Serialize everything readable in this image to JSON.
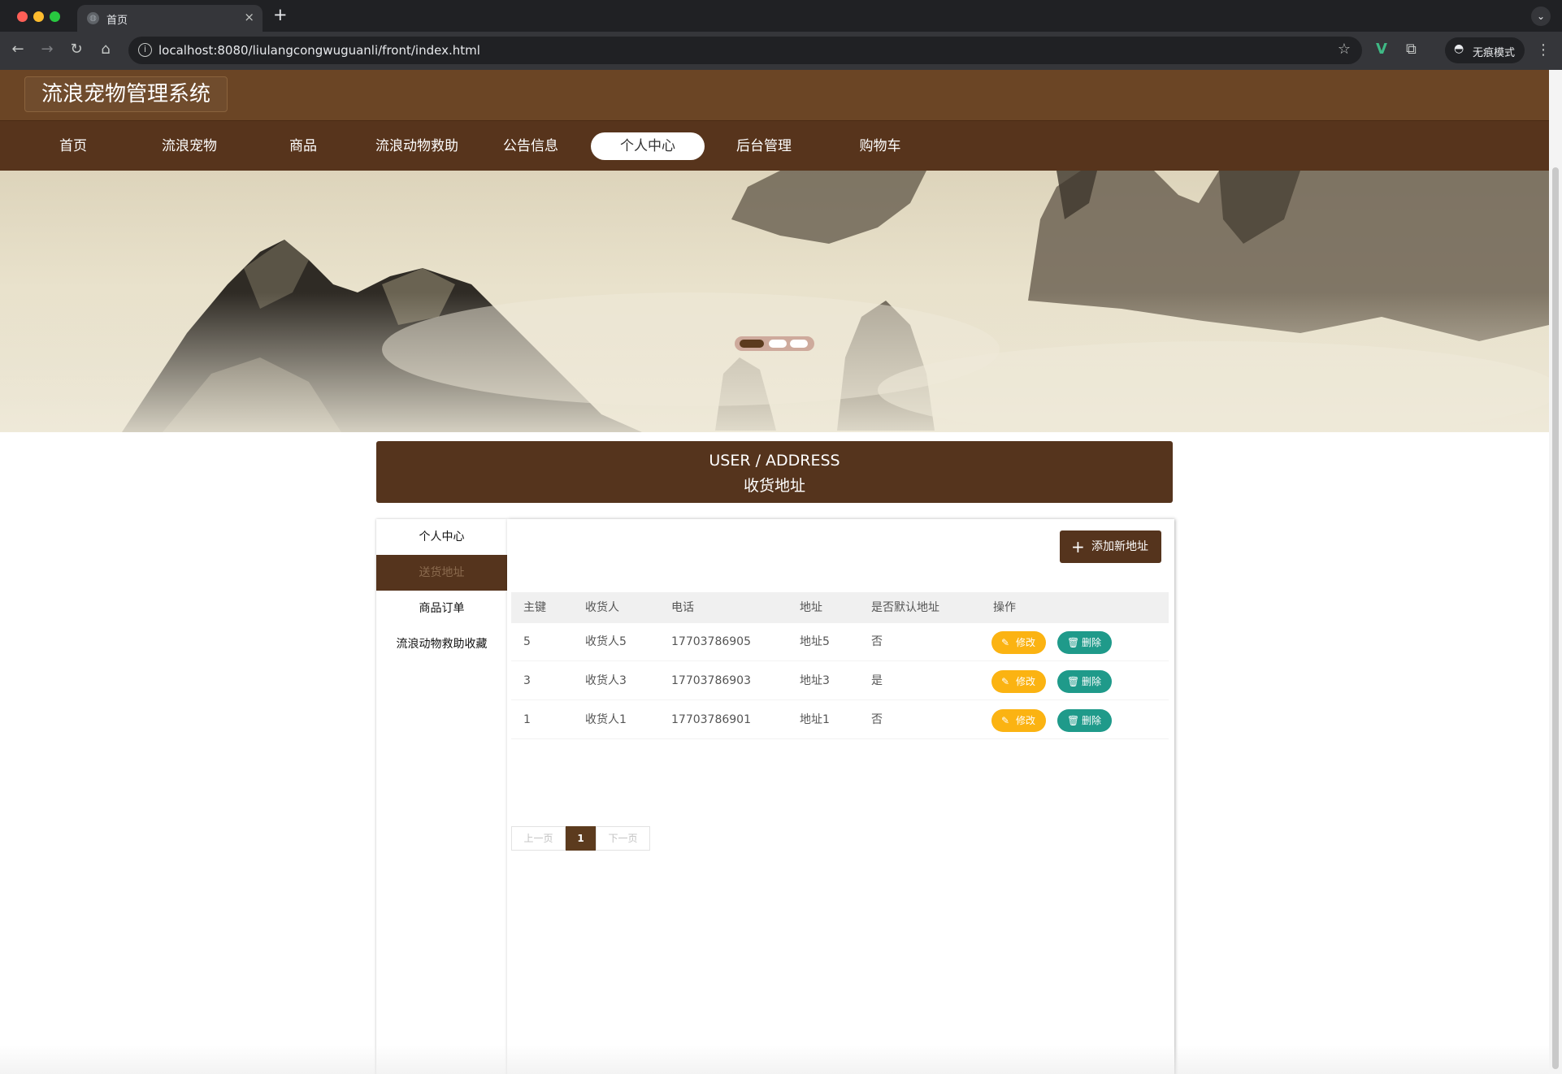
{
  "browser": {
    "tab_title": "首页",
    "tab_close": "×",
    "new_tab": "+",
    "url": "localhost:8080/liulangcongwuguanli/front/index.html",
    "incognito_label": "无痕模式",
    "icons": [
      "back-icon",
      "forward-icon",
      "reload-icon",
      "home-icon",
      "info-icon",
      "star-icon",
      "vue-devtools-icon",
      "extensions-icon",
      "incognito-icon",
      "menu-icon"
    ]
  },
  "header": {
    "brand": "流浪宠物管理系统"
  },
  "nav": {
    "items": [
      {
        "label": "首页"
      },
      {
        "label": "流浪宠物"
      },
      {
        "label": "商品"
      },
      {
        "label": "流浪动物救助"
      },
      {
        "label": "公告信息"
      },
      {
        "label": "个人中心",
        "active": true
      },
      {
        "label": "后台管理"
      },
      {
        "label": "购物车"
      }
    ]
  },
  "banner": {
    "slides": 3,
    "active_slide": 1
  },
  "section": {
    "title_en": "USER / ADDRESS",
    "title_cn": "收货地址"
  },
  "sidebar": {
    "items": [
      {
        "label": "个人中心"
      },
      {
        "label": "送货地址",
        "active": true
      },
      {
        "label": "商品订单"
      },
      {
        "label": "流浪动物救助收藏"
      }
    ]
  },
  "content": {
    "add_button": "添加新地址",
    "columns": [
      "主键",
      "收货人",
      "电话",
      "地址",
      "是否默认地址",
      "操作"
    ],
    "rows": [
      {
        "id": "5",
        "name": "收货人5",
        "phone": "17703786905",
        "address": "地址5",
        "default": "否"
      },
      {
        "id": "3",
        "name": "收货人3",
        "phone": "17703786903",
        "address": "地址3",
        "default": "是"
      },
      {
        "id": "1",
        "name": "收货人1",
        "phone": "17703786901",
        "address": "地址1",
        "default": "否"
      }
    ],
    "edit_label": "修改",
    "delete_label": "删除",
    "pager": {
      "prev": "上一页",
      "current": "1",
      "next": "下一页"
    }
  },
  "colors": {
    "header": "#6b4525",
    "nav": "#57341c",
    "accent": "#55341d",
    "edit": "#fbb312",
    "delete": "#1f9a8a"
  }
}
